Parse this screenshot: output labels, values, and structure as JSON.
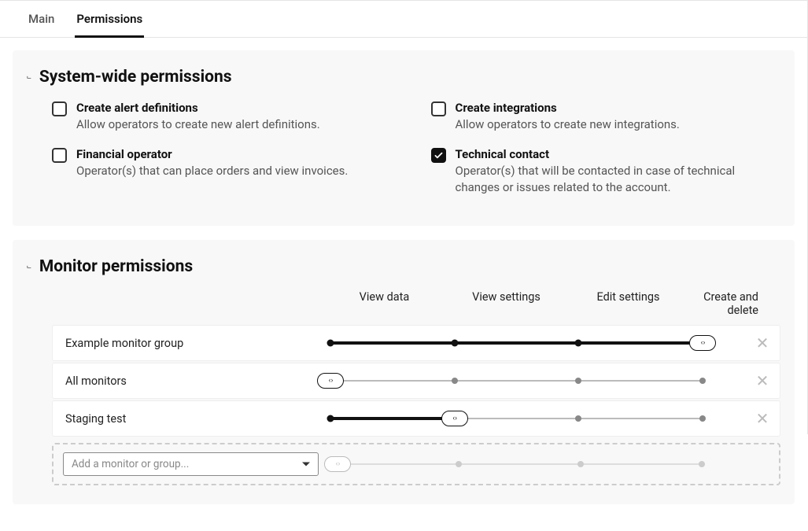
{
  "tabs": [
    {
      "label": "Main",
      "active": false
    },
    {
      "label": "Permissions",
      "active": true
    }
  ],
  "systemPermissions": {
    "title": "System-wide permissions",
    "items": [
      {
        "label": "Create alert definitions",
        "desc": "Allow operators to create new alert definitions.",
        "checked": false
      },
      {
        "label": "Create integrations",
        "desc": "Allow operators to create new integrations.",
        "checked": false
      },
      {
        "label": "Financial operator",
        "desc": "Operator(s) that can place orders and view invoices.",
        "checked": false
      },
      {
        "label": "Technical contact",
        "desc": "Operator(s) that will be contacted in case of technical changes or issues related to the account.",
        "checked": true
      }
    ]
  },
  "monitorPermissions": {
    "title": "Monitor permissions",
    "levels": [
      "View data",
      "View settings",
      "Edit settings",
      "Create and delete"
    ],
    "rows": [
      {
        "name": "Example monitor group",
        "level": 3
      },
      {
        "name": "All monitors",
        "level": 0
      },
      {
        "name": "Staging test",
        "level": 1
      }
    ],
    "addPlaceholder": "Add a monitor or group..."
  }
}
